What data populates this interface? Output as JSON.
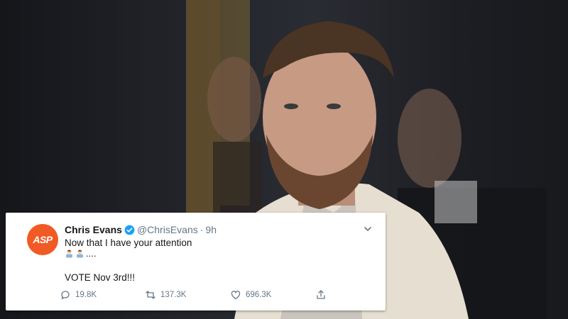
{
  "photo": {
    "description_icon": "photo-background"
  },
  "tweet": {
    "avatar_text": "ASP",
    "display_name": "Chris Evans",
    "handle": "@ChrisEvans",
    "dot": "·",
    "time": "9h",
    "line1": "Now that I have your attention",
    "emoji_suffix": "....",
    "line2": "VOTE Nov 3rd!!!",
    "reply_count": "19.8K",
    "retweet_count": "137.3K",
    "like_count": "696.3K",
    "colors": {
      "avatar": "#f15a24",
      "verified": "#1da1f2",
      "muted": "#657786"
    }
  }
}
